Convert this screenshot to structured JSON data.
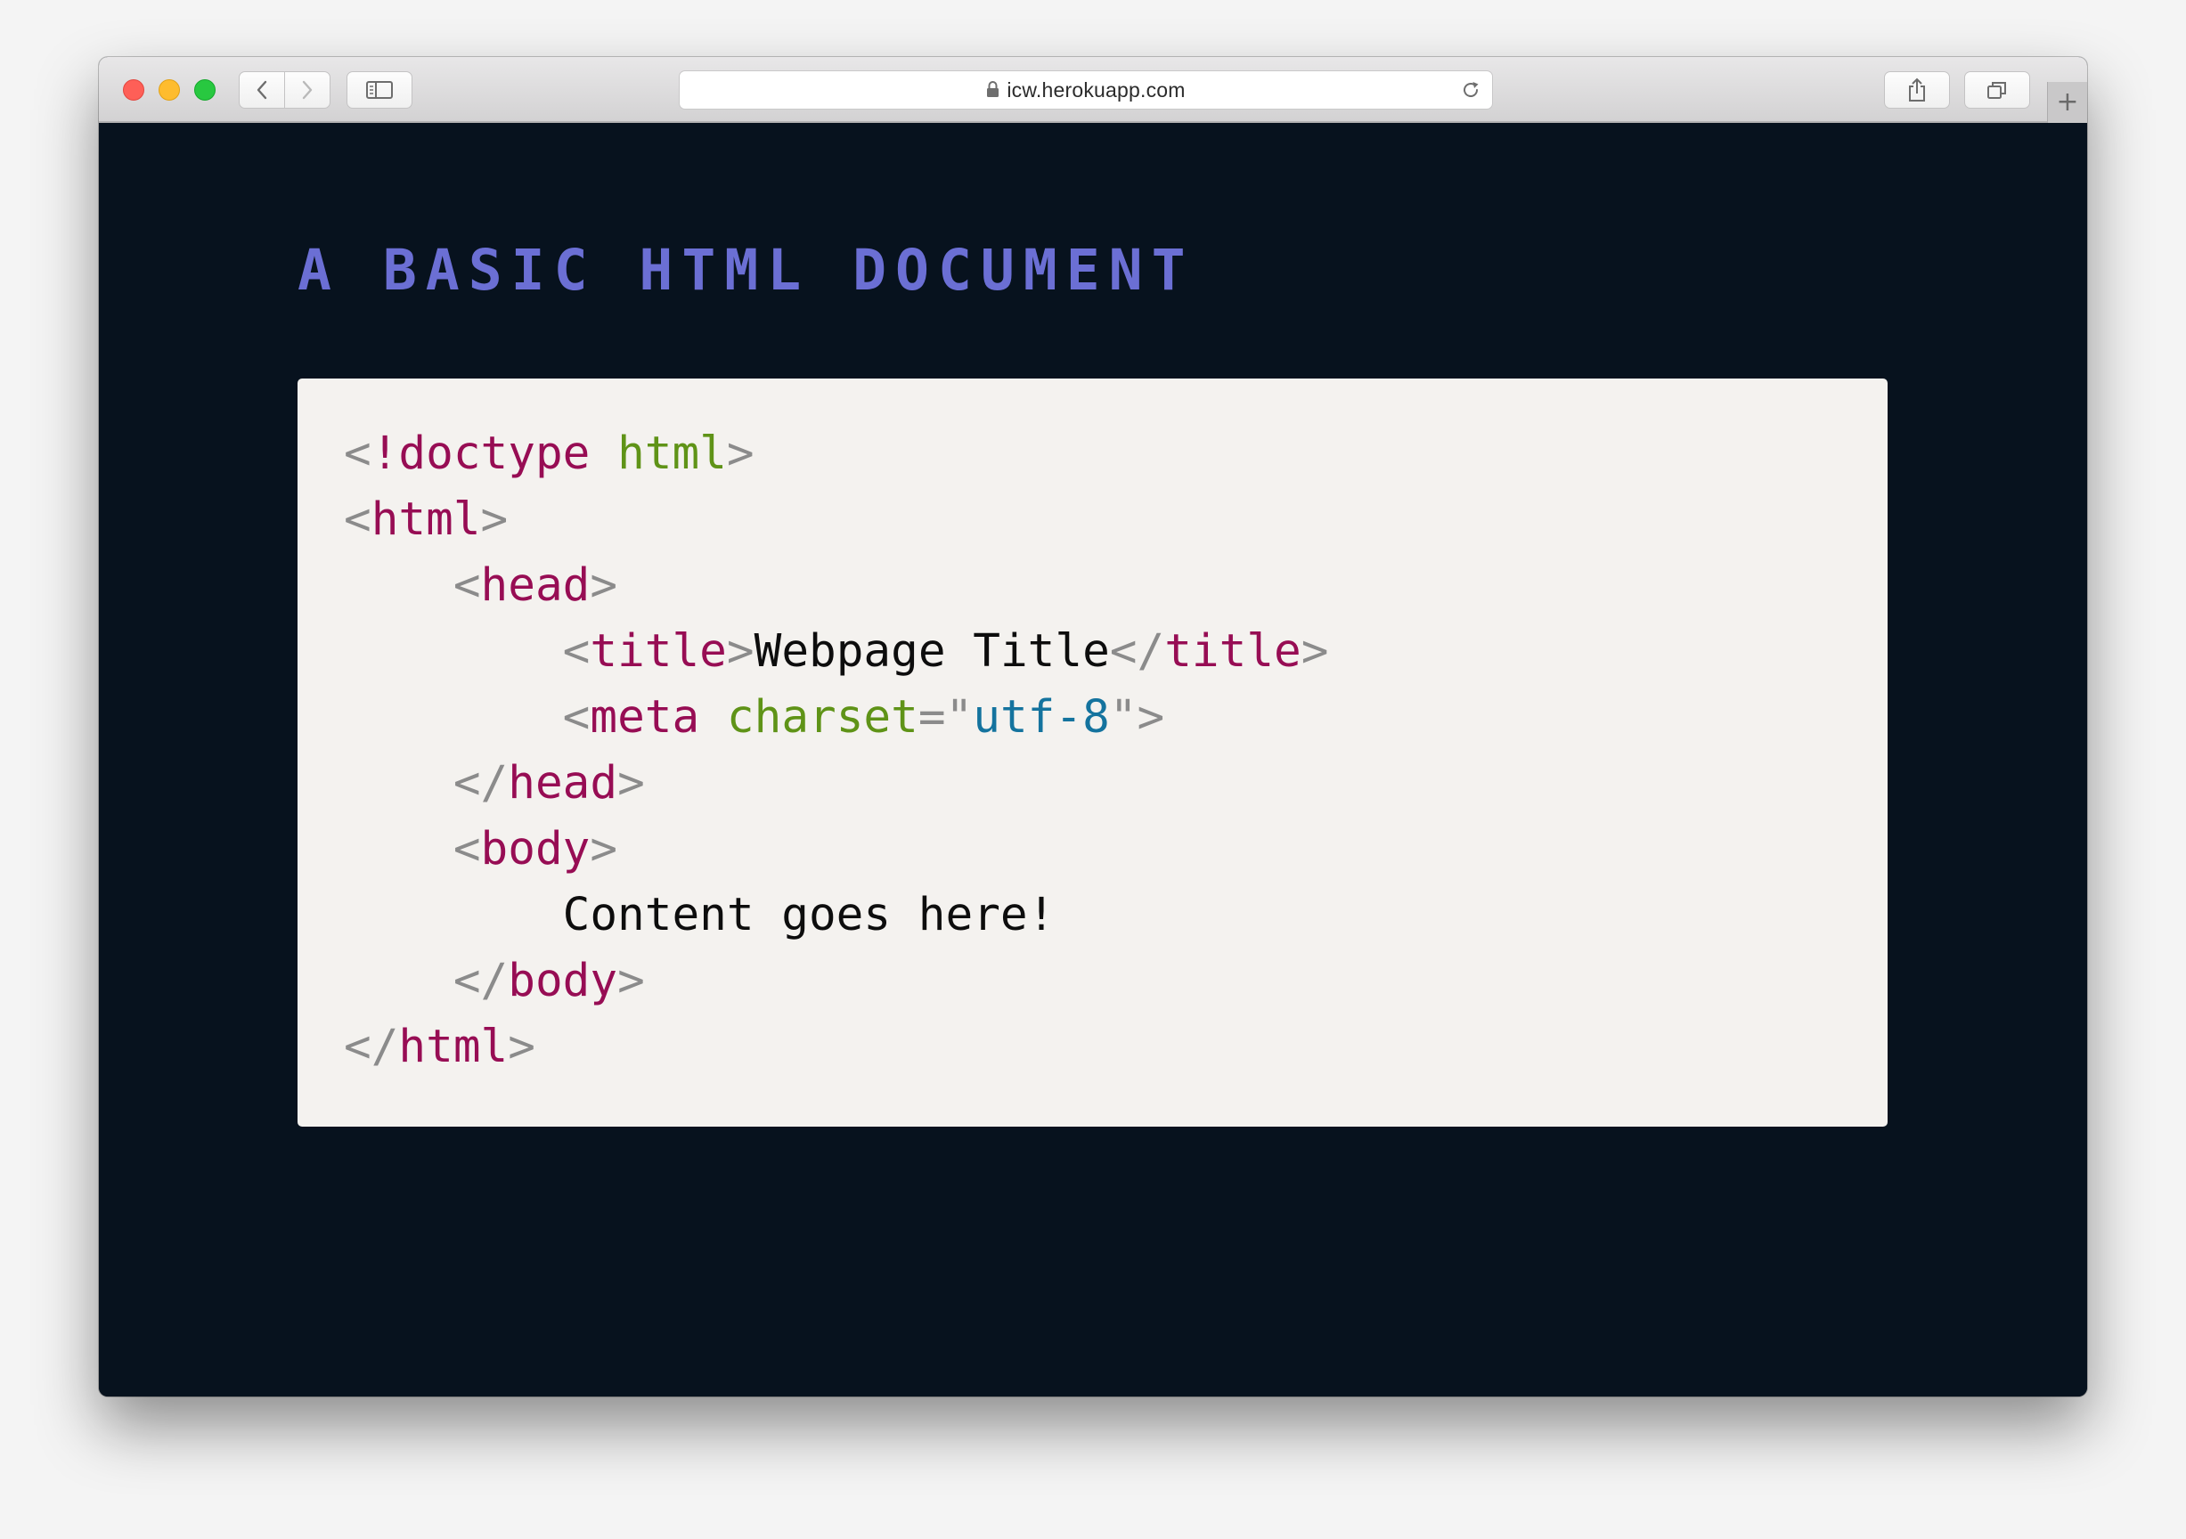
{
  "browser": {
    "url": "icw.herokuapp.com",
    "icons": {
      "back": "chevron-left-icon",
      "forward": "chevron-right-icon",
      "sidebar": "sidebar-icon",
      "lock": "lock-icon",
      "reload": "reload-icon",
      "share": "share-icon",
      "tabs": "tabs-overview-icon",
      "new_tab": "plus-icon"
    },
    "new_tab_label": "+"
  },
  "page": {
    "title": "A BASIC HTML DOCUMENT",
    "background_color": "#07121e",
    "title_color": "#6b6fd4",
    "panel_color": "#f4f2ef"
  },
  "code": {
    "syntax_colors": {
      "punctuation": "#8b8b8b",
      "tag": "#970d54",
      "attribute": "#5f9317",
      "string": "#14739e",
      "text": "#0d0d0d"
    },
    "lines": [
      [
        {
          "t": "p",
          "v": "<"
        },
        {
          "t": "t",
          "v": "!doctype"
        },
        {
          "t": "tx",
          "v": " "
        },
        {
          "t": "a",
          "v": "html"
        },
        {
          "t": "p",
          "v": ">"
        }
      ],
      [
        {
          "t": "p",
          "v": "<"
        },
        {
          "t": "t",
          "v": "html"
        },
        {
          "t": "p",
          "v": ">"
        }
      ],
      [
        {
          "t": "tx",
          "v": "    "
        },
        {
          "t": "p",
          "v": "<"
        },
        {
          "t": "t",
          "v": "head"
        },
        {
          "t": "p",
          "v": ">"
        }
      ],
      [
        {
          "t": "tx",
          "v": "        "
        },
        {
          "t": "p",
          "v": "<"
        },
        {
          "t": "t",
          "v": "title"
        },
        {
          "t": "p",
          "v": ">"
        },
        {
          "t": "tx",
          "v": "Webpage Title"
        },
        {
          "t": "p",
          "v": "</"
        },
        {
          "t": "t",
          "v": "title"
        },
        {
          "t": "p",
          "v": ">"
        }
      ],
      [
        {
          "t": "tx",
          "v": "        "
        },
        {
          "t": "p",
          "v": "<"
        },
        {
          "t": "t",
          "v": "meta"
        },
        {
          "t": "tx",
          "v": " "
        },
        {
          "t": "a",
          "v": "charset"
        },
        {
          "t": "p",
          "v": "=\""
        },
        {
          "t": "s",
          "v": "utf-8"
        },
        {
          "t": "p",
          "v": "\">"
        }
      ],
      [
        {
          "t": "tx",
          "v": "    "
        },
        {
          "t": "p",
          "v": "</"
        },
        {
          "t": "t",
          "v": "head"
        },
        {
          "t": "p",
          "v": ">"
        }
      ],
      [
        {
          "t": "tx",
          "v": "    "
        },
        {
          "t": "p",
          "v": "<"
        },
        {
          "t": "t",
          "v": "body"
        },
        {
          "t": "p",
          "v": ">"
        }
      ],
      [
        {
          "t": "tx",
          "v": "        Content goes here!"
        }
      ],
      [
        {
          "t": "tx",
          "v": "    "
        },
        {
          "t": "p",
          "v": "</"
        },
        {
          "t": "t",
          "v": "body"
        },
        {
          "t": "p",
          "v": ">"
        }
      ],
      [
        {
          "t": "p",
          "v": "</"
        },
        {
          "t": "t",
          "v": "html"
        },
        {
          "t": "p",
          "v": ">"
        }
      ]
    ]
  }
}
